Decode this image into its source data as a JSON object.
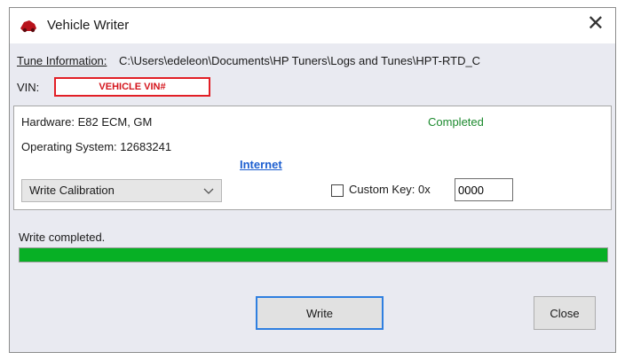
{
  "window": {
    "title": "Vehicle Writer",
    "close_glyph": "✕",
    "icon": "car-icon",
    "accent_color": "#2f7fe0"
  },
  "info": {
    "tune_label": "Tune Information:",
    "tune_path": "C:\\Users\\edeleon\\Documents\\HP Tuners\\Logs and Tunes\\HPT-RTD_C",
    "vin_label": "VIN:",
    "vin_value": "VEHICLE VIN#"
  },
  "details": {
    "hardware": "Hardware: E82 ECM, GM",
    "os": "Operating System: 12683241",
    "state": "Completed",
    "internet_link": "Internet",
    "mode_select": "Write Calibration",
    "custom_key_label": "Custom Key: 0x",
    "custom_key_value": "0000",
    "custom_key_checked": false
  },
  "progress": {
    "status_text": "Write completed.",
    "value_percent": 100,
    "bar_color": "#07b025"
  },
  "buttons": {
    "write": "Write",
    "close": "Close"
  }
}
